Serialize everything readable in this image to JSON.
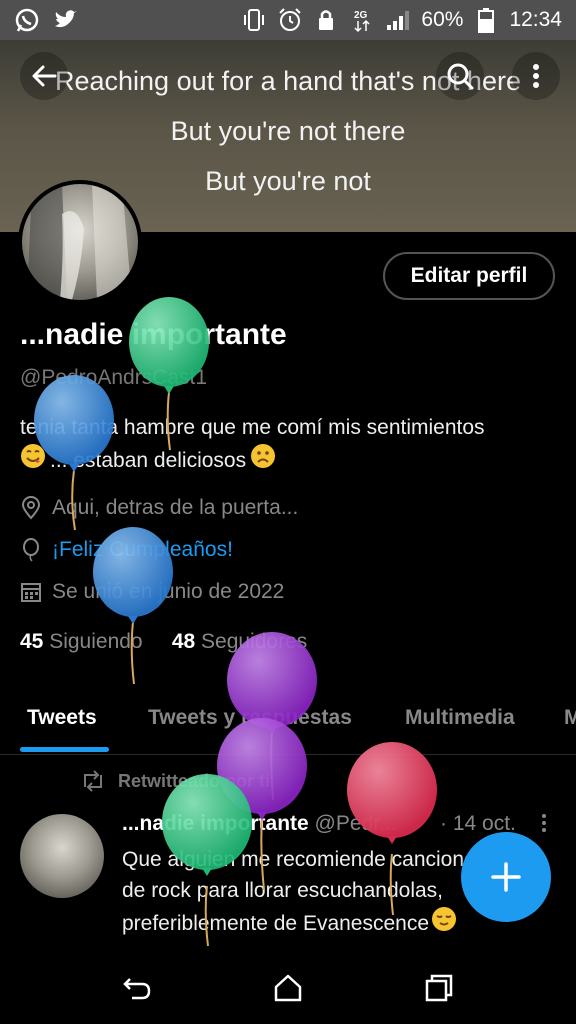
{
  "status_bar": {
    "battery_percent": "60%",
    "time": "12:34",
    "left_icons": [
      "whatsapp-icon",
      "twitter-bird-icon"
    ],
    "right_icons": [
      "vibrate-icon",
      "alarm-icon",
      "lock-icon",
      "data-2g-icon",
      "signal-icon",
      "battery-icon"
    ]
  },
  "banner": {
    "lines": [
      "Reaching out for a hand that's not here",
      "But you're not there",
      "But you're not"
    ]
  },
  "header": {
    "back_icon": "back-arrow-icon",
    "search_icon": "search-icon",
    "more_icon": "more-vertical-icon"
  },
  "profile": {
    "edit_label": "Editar perfil",
    "name": "...nadie importante",
    "handle": "@PedroAndrsCast1",
    "bio_line1": "tenia tanta hambre que me comí mis sentimientos",
    "bio_line2": "... estaban deliciosos",
    "location": "Aqui, detras de la puerta...",
    "birthday": "¡Feliz Cumpleaños!",
    "joined": "Se unió en junio de 2022",
    "following_count": "45",
    "following_label": "Siguiendo",
    "followers_count": "48",
    "followers_label": "Seguidores"
  },
  "tabs": [
    {
      "label": "Tweets",
      "active": true
    },
    {
      "label": "Tweets y respuestas",
      "active": false
    },
    {
      "label": "Multimedia",
      "active": false
    },
    {
      "label": "M",
      "active": false
    }
  ],
  "tweet": {
    "retweet_label": "Retwitteado por ti",
    "author_name": "...nadie importante",
    "author_handle": "@Pedr...",
    "date": "· 14 oct.",
    "text_line1": "Que alguien me recomiende canciones",
    "text_line2": "de rock para llorar escuchandolas,",
    "text_line3": "preferiblemente de Evanescence"
  },
  "nav": {
    "icons": [
      "back-nav-icon",
      "home-nav-icon",
      "recents-nav-icon"
    ]
  },
  "colors": {
    "accent": "#1d9bf0",
    "balloon_green": "#2ed38a",
    "balloon_blue": "#3a8fe0",
    "balloon_purple": "#9b2fd6",
    "balloon_red": "#e8395a"
  }
}
